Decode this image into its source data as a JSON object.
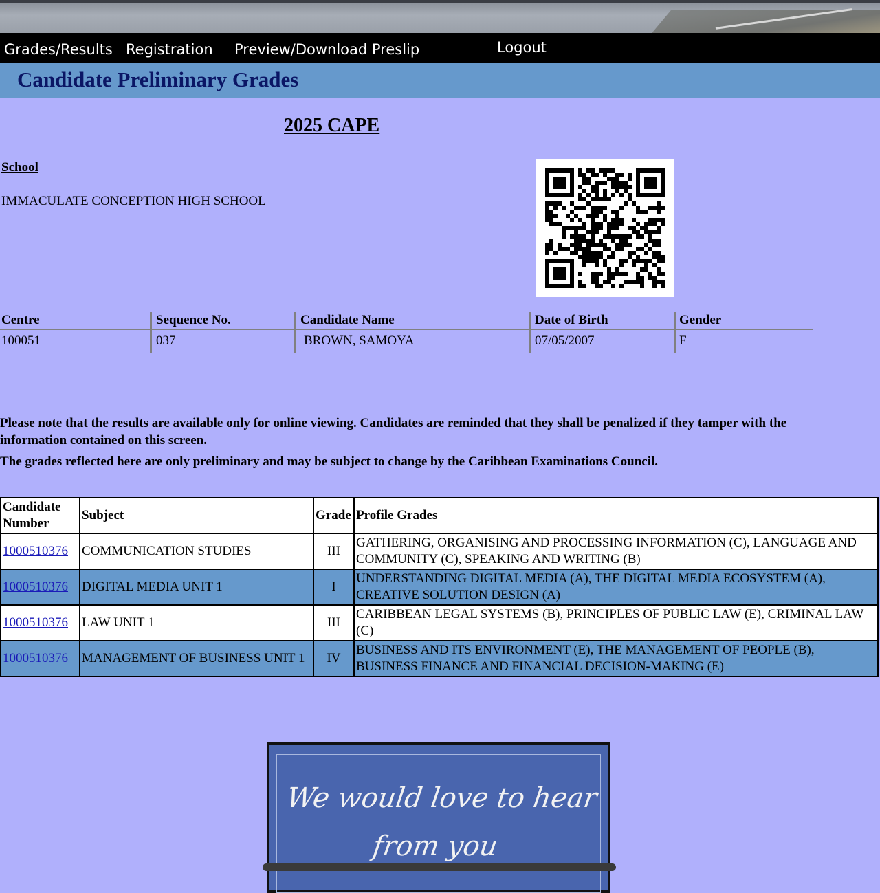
{
  "nav": {
    "grades_results": "Grades/Results",
    "registration": "Registration",
    "preview_download": "Preview/Download Preslip",
    "logout": "Logout"
  },
  "page_title": "Candidate Preliminary Grades",
  "exam_heading": "2025 CAPE",
  "school": {
    "label": "School",
    "name": "IMMACULATE CONCEPTION HIGH SCHOOL"
  },
  "candidate_info": {
    "headers": {
      "centre": "Centre",
      "sequence": "Sequence No.",
      "name": "Candidate Name",
      "dob": "Date of Birth",
      "gender": "Gender"
    },
    "values": {
      "centre": "100051",
      "sequence": "037",
      "name": "BROWN, SAMOYA",
      "dob": "07/05/2007",
      "gender": "F"
    }
  },
  "notices": {
    "line1": "Please note that the results are available only for online viewing. Candidates are reminded that they shall be penalized if they tamper with the information contained on this screen.",
    "line2": "The grades reflected here are only preliminary and may be subject to change by the Caribbean Examinations Council."
  },
  "grades_table": {
    "headers": {
      "candidate_number": "Candidate Number",
      "subject": "Subject",
      "grade": "Grade",
      "profile_grades": "Profile Grades"
    },
    "rows": [
      {
        "candidate_number": "1000510376",
        "subject": "COMMUNICATION STUDIES",
        "grade": "III",
        "profile": "GATHERING, ORGANISING AND PROCESSING INFORMATION (C), LANGUAGE AND COMMUNITY (C), SPEAKING AND WRITING (B)"
      },
      {
        "candidate_number": "1000510376",
        "subject": "DIGITAL MEDIA UNIT 1",
        "grade": "I",
        "profile": "UNDERSTANDING DIGITAL MEDIA (A), THE DIGITAL MEDIA ECOSYSTEM (A), CREATIVE SOLUTION DESIGN (A)"
      },
      {
        "candidate_number": "1000510376",
        "subject": "LAW UNIT 1",
        "grade": "III",
        "profile": "CARIBBEAN LEGAL SYSTEMS (B), PRINCIPLES OF PUBLIC LAW (E), CRIMINAL LAW (C)"
      },
      {
        "candidate_number": "1000510376",
        "subject": "MANAGEMENT OF BUSINESS UNIT 1",
        "grade": "IV",
        "profile": "BUSINESS AND ITS ENVIRONMENT (E), THE MANAGEMENT OF PEOPLE (B), BUSINESS FINANCE AND FINANCIAL DECISION-MAKING (E)"
      }
    ]
  },
  "feedback": {
    "line1": "We would love to hear",
    "line2": "from you"
  },
  "colors": {
    "page_background": "#b0b0fc",
    "title_bar": "#6699cc",
    "title_text": "#0b1665",
    "nav_background": "#000000",
    "feedback_board": "#4965ae"
  }
}
